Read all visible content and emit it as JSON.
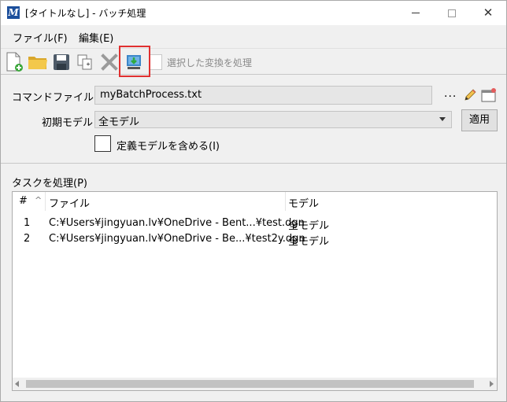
{
  "window": {
    "title": "[タイトルなし] - バッチ処理",
    "app_icon": "M",
    "close_glyph": "✕"
  },
  "menu": {
    "file": "ファイル(F)",
    "edit": "編集(E)"
  },
  "toolbar": {
    "icons": [
      "new-document-icon",
      "open-folder-icon",
      "save-icon",
      "copy-icon",
      "delete-icon",
      "process-icon"
    ],
    "process_selected_label": "選択した変換を処理"
  },
  "form": {
    "command_file_label": "コマンドファイル",
    "command_file_value": "myBatchProcess.txt",
    "browse_label": "...",
    "initial_model_label": "初期モデル",
    "initial_model_value": "全モデル",
    "apply_label": "適用",
    "include_defs_label": "定義モデルを含める(I)"
  },
  "tasks": {
    "section_label": "タスクを処理(P)",
    "columns": {
      "num": "#",
      "sort_glyph": "^",
      "file": "ファイル",
      "model": "モデル"
    },
    "rows": [
      {
        "num": "1",
        "file": "C:¥Users¥jingyuan.lv¥OneDrive - Bent...¥test.dgn",
        "model": "全モデル"
      },
      {
        "num": "2",
        "file": "C:¥Users¥jingyuan.lv¥OneDrive - Be...¥test2y.dgn",
        "model": "全モデル"
      }
    ]
  },
  "colors": {
    "highlight": "#e03030",
    "title_icon": "#1c4f9c"
  }
}
